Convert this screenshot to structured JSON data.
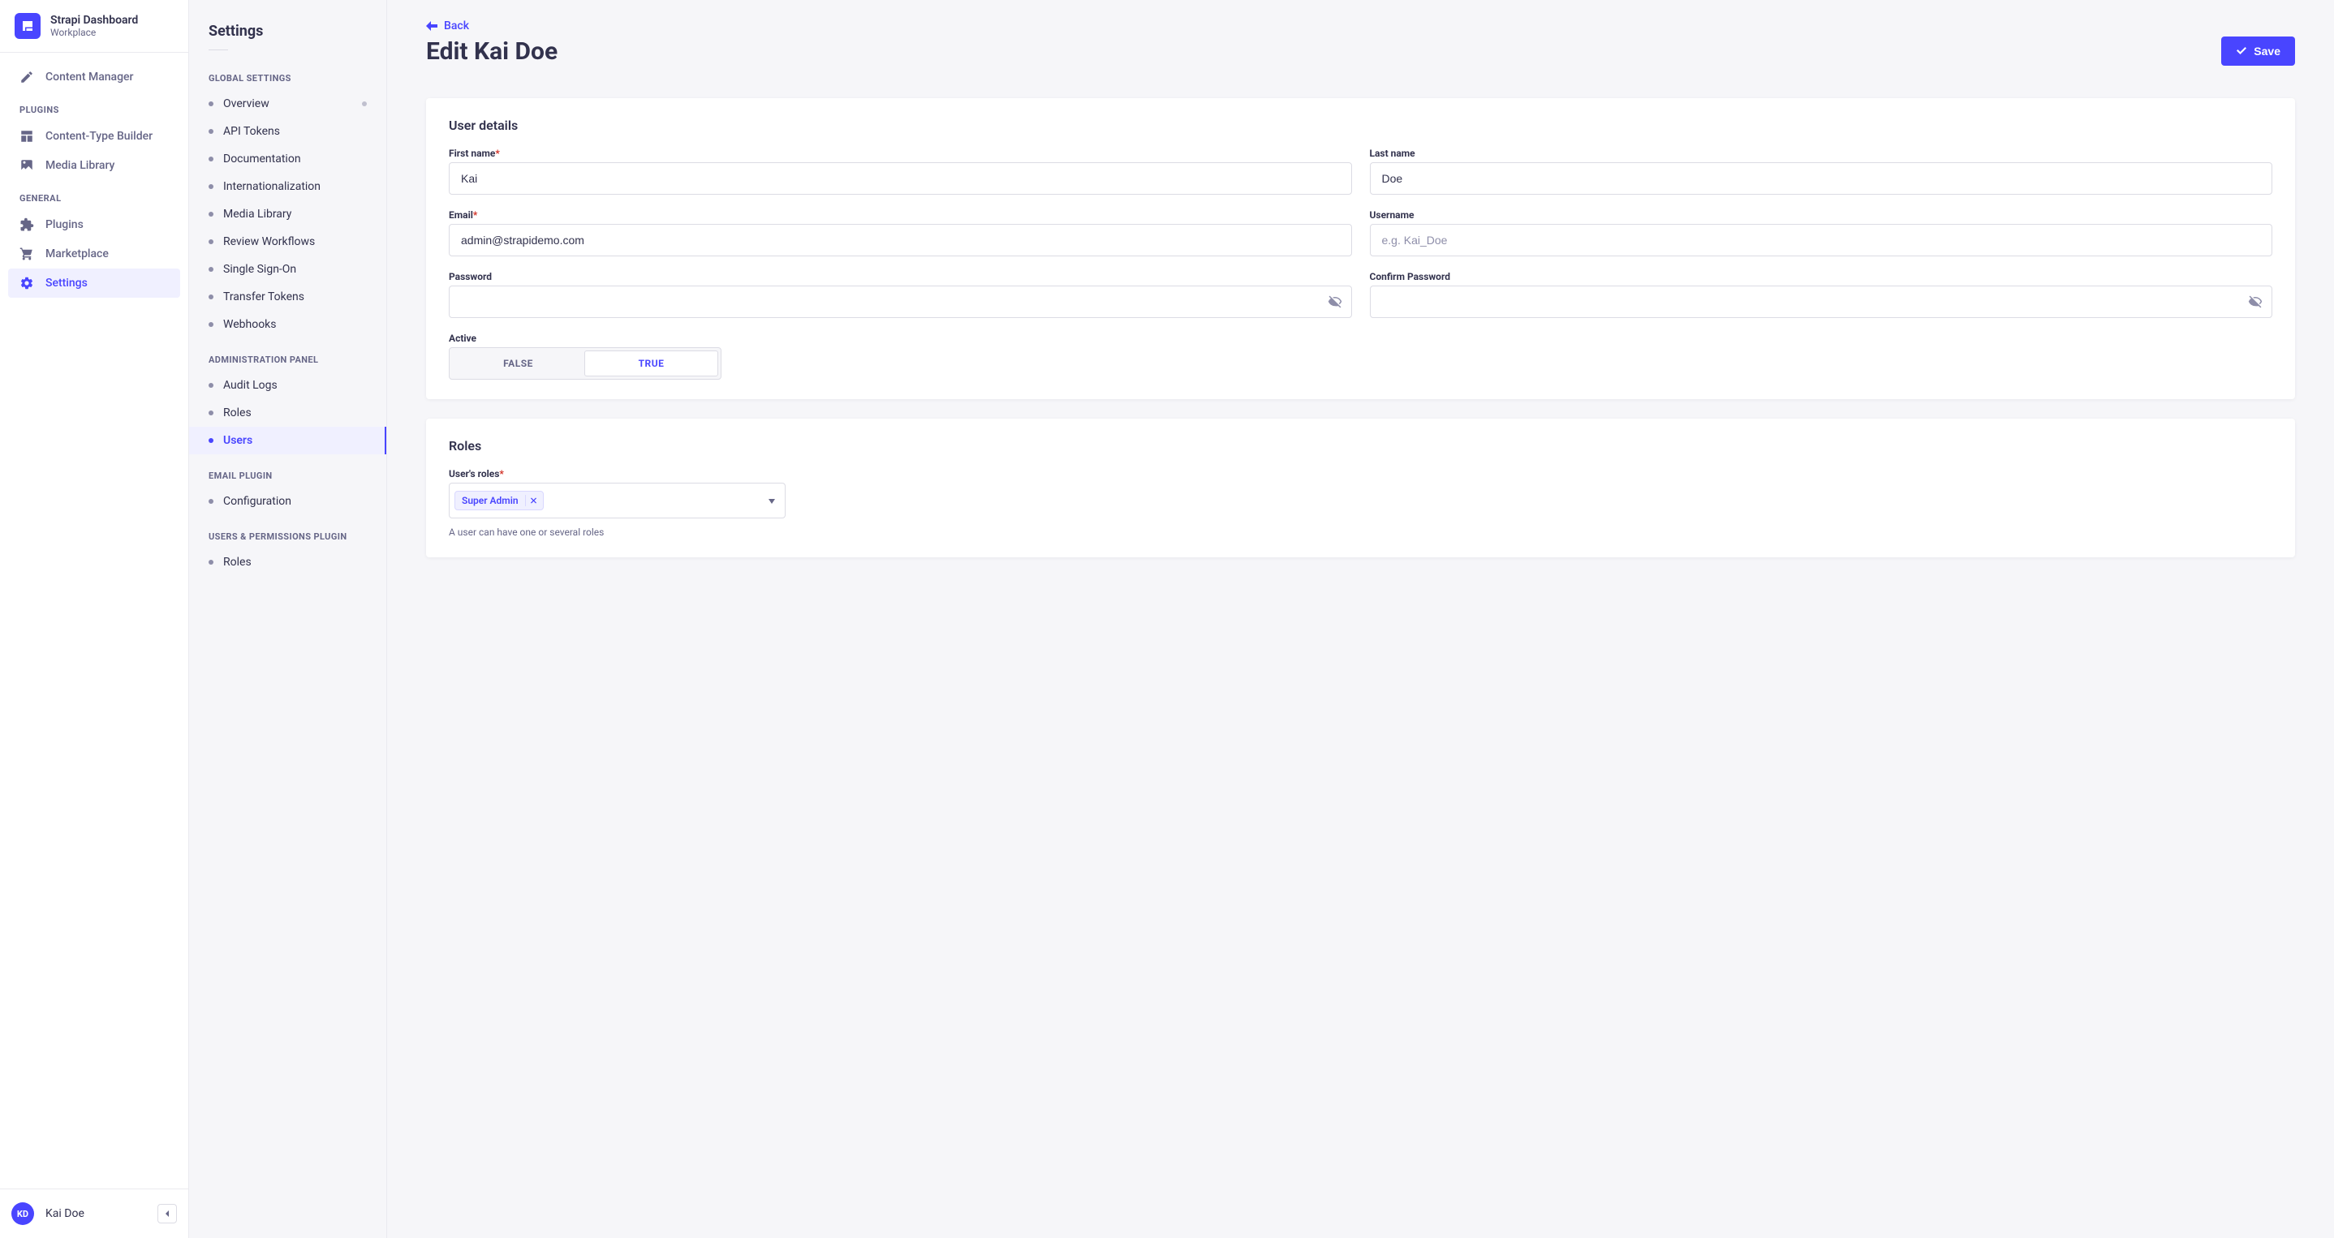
{
  "brand": {
    "title": "Strapi Dashboard",
    "subtitle": "Workplace"
  },
  "primaryNav": {
    "contentManager": "Content Manager",
    "pluginsLabel": "PLUGINS",
    "contentTypeBuilder": "Content-Type Builder",
    "mediaLibrary": "Media Library",
    "generalLabel": "GENERAL",
    "plugins": "Plugins",
    "marketplace": "Marketplace",
    "settings": "Settings"
  },
  "settingsSidebar": {
    "heading": "Settings",
    "globalLabel": "GLOBAL SETTINGS",
    "global": {
      "overview": "Overview",
      "apiTokens": "API Tokens",
      "documentation": "Documentation",
      "i18n": "Internationalization",
      "mediaLibrary": "Media Library",
      "reviewWorkflows": "Review Workflows",
      "sso": "Single Sign-On",
      "transferTokens": "Transfer Tokens",
      "webhooks": "Webhooks"
    },
    "adminLabel": "ADMINISTRATION PANEL",
    "admin": {
      "auditLogs": "Audit Logs",
      "roles": "Roles",
      "users": "Users"
    },
    "emailLabel": "EMAIL PLUGIN",
    "email": {
      "configuration": "Configuration"
    },
    "uapLabel": "USERS & PERMISSIONS PLUGIN",
    "uap": {
      "roles": "Roles"
    }
  },
  "page": {
    "back": "Back",
    "title": "Edit Kai Doe",
    "save": "Save"
  },
  "userDetails": {
    "heading": "User details",
    "firstNameLabel": "First name",
    "firstName": "Kai",
    "lastNameLabel": "Last name",
    "lastName": "Doe",
    "emailLabel": "Email",
    "email": "admin@strapidemo.com",
    "usernameLabel": "Username",
    "usernamePlaceholder": "e.g. Kai_Doe",
    "passwordLabel": "Password",
    "confirmPasswordLabel": "Confirm Password",
    "activeLabel": "Active",
    "falseLabel": "FALSE",
    "trueLabel": "TRUE"
  },
  "roles": {
    "heading": "Roles",
    "fieldLabel": "User's roles",
    "tag": "Super Admin",
    "hint": "A user can have one or several roles"
  },
  "footerUser": {
    "initials": "KD",
    "name": "Kai Doe"
  }
}
